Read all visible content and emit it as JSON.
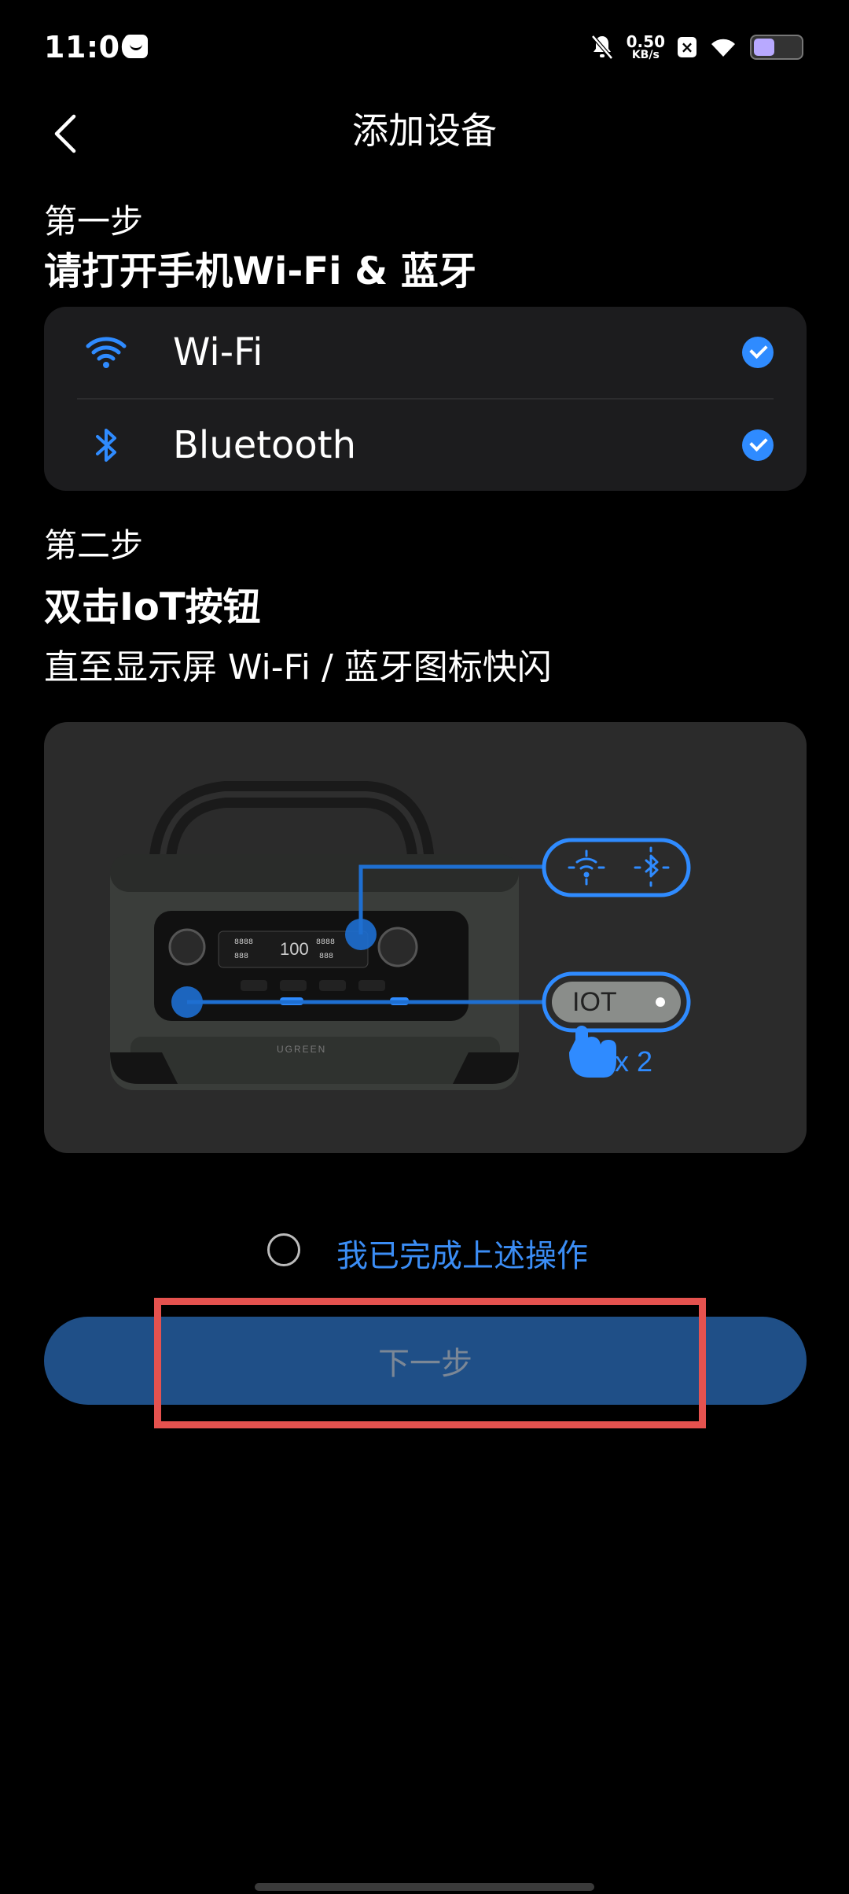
{
  "status_bar": {
    "time": "11:06",
    "net_speed_value": "0.50",
    "net_speed_unit": "KB/s",
    "battery_level": 0.4,
    "battery_color": "#b8a9ff"
  },
  "header": {
    "title": "添加设备"
  },
  "step1": {
    "label": "第一步",
    "title": "请打开手机Wi-Fi & 蓝牙",
    "items": [
      {
        "label": "Wi-Fi",
        "icon": "wifi-icon",
        "checked": true
      },
      {
        "label": "Bluetooth",
        "icon": "bluetooth-icon",
        "checked": true
      }
    ]
  },
  "step2": {
    "label": "第二步",
    "title": "双击IoT按钮",
    "description": "直至显示屏 Wi-Fi / 蓝牙图标快闪"
  },
  "illustration": {
    "display_number": "100",
    "brand": "UGREEN",
    "iot_button_label": "IOT",
    "tap_count": "x 2"
  },
  "confirm": {
    "label": "我已完成上述操作",
    "checked": false
  },
  "next_button": {
    "label": "下一步"
  },
  "colors": {
    "accent": "#2f8bff",
    "button_bg": "#1f4f87",
    "highlight": "#e5524f"
  }
}
